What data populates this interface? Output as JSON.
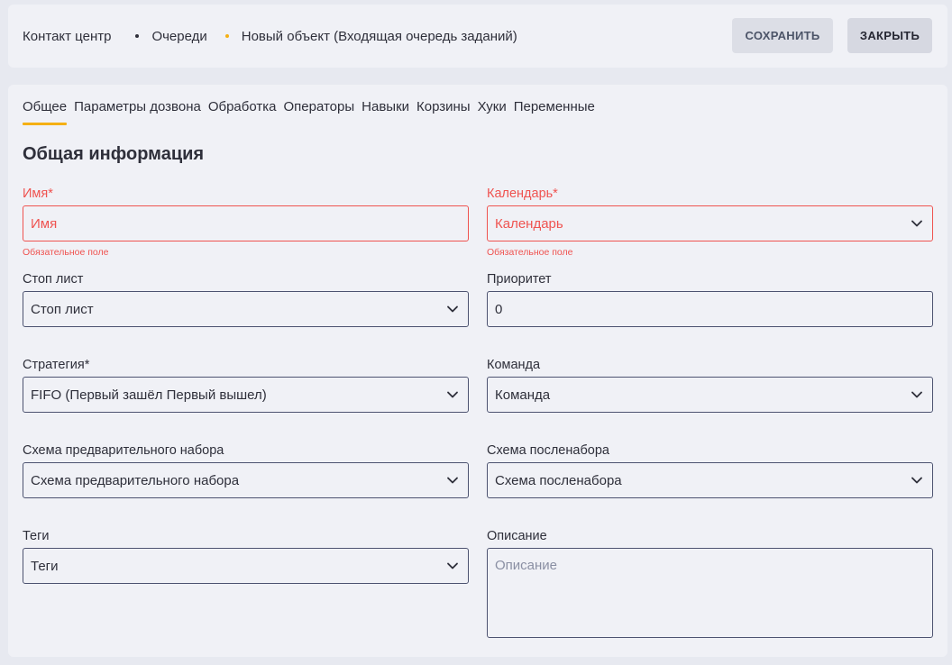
{
  "breadcrumbs": [
    "Контакт центр",
    "Очереди",
    "Новый объект (Входящая очередь заданий)"
  ],
  "buttons": {
    "save": "СОХРАНИТЬ",
    "close": "ЗАКРЫТЬ"
  },
  "tabs": [
    "Общее",
    "Параметры дозвона",
    "Обработка",
    "Операторы",
    "Навыки",
    "Корзины",
    "Хуки",
    "Переменные"
  ],
  "active_tab": "Общее",
  "section_title": "Общая информация",
  "required_hint": "Обязательное поле",
  "fields": {
    "name": {
      "label": "Имя*",
      "placeholder": "Имя"
    },
    "calendar": {
      "label": "Календарь*",
      "placeholder": "Календарь"
    },
    "stop_list": {
      "label": "Стоп лист",
      "value": "Стоп лист"
    },
    "priority": {
      "label": "Приоритет",
      "value": "0"
    },
    "strategy": {
      "label": "Стратегия*",
      "value": "FIFO (Первый зашёл Первый вышел)"
    },
    "team": {
      "label": "Команда",
      "value": "Команда"
    },
    "pre_dial": {
      "label": "Схема предварительного набора",
      "value": "Схема предварительного набора"
    },
    "post_dial": {
      "label": "Схема посленабора",
      "value": "Схема посленабора"
    },
    "tags": {
      "label": "Теги",
      "value": "Теги"
    },
    "description": {
      "label": "Описание",
      "placeholder": "Описание"
    }
  },
  "colors": {
    "accent": "#f5b014",
    "error": "#ef5350",
    "border": "#4d5370"
  }
}
